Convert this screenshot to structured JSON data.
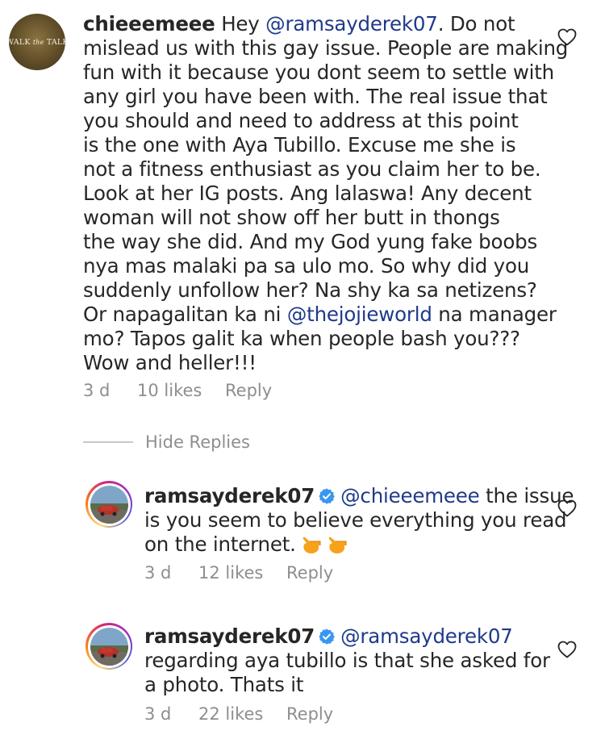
{
  "comments": [
    {
      "username": "chieeemeee",
      "avatar_text": "WALK the TALK",
      "lines": [
        "Hey ",
        "mislead us with this gay issue. People are making",
        "fun with it because you dont seem to settle with",
        "any girl you have been with. The real issue that",
        "you should and need to address at this point",
        "is the one with Aya Tubillo. Excuse me she is",
        "not a fitness enthusiast as you claim her to be.",
        "Look at her IG posts. Ang lalaswa! Any decent",
        "woman will not show off her butt in thongs",
        "the way she did. And my God yung fake boobs",
        "nya mas malaki pa sa ulo mo. So why did you",
        "suddenly unfollow her? Na shy ka sa netizens?",
        "Or napagalitan ka ni ",
        "mo? Tapos galit ka when people bash you???",
        "Wow and heller!!!"
      ],
      "mention_1": "@ramsayderek07",
      "after_mention_1": ". Do not",
      "mention_2": "@thejojieworld",
      "after_mention_2": " na manager",
      "time": "3 d",
      "likes": "10 likes",
      "reply_label": "Reply"
    }
  ],
  "hide_replies_label": "Hide Replies",
  "replies": [
    {
      "username": "ramsayderek07",
      "verified": true,
      "mention": "@chieeemeee",
      "line1_tail": " the issue",
      "line2": "is you seem to believe everything you read",
      "line3": "on the internet.",
      "emojis": [
        "backhand-index-pointing-left",
        "backhand-index-pointing-left"
      ],
      "time": "3 d",
      "likes": "12 likes",
      "reply_label": "Reply"
    },
    {
      "username": "ramsayderek07",
      "verified": true,
      "mention": "@ramsayderek07",
      "line2": "regarding aya tubillo is that she asked for",
      "line3": "a photo. Thats it",
      "time": "3 d",
      "likes": "22 likes",
      "reply_label": "Reply"
    }
  ],
  "colors": {
    "text": "#262626",
    "meta": "#8e8e8e",
    "mention": "#1f3a8a",
    "verified": "#3897f0",
    "divider": "#c7c7c7"
  },
  "icons": {
    "like": "heart-outline-icon",
    "verified": "verified-badge-icon"
  }
}
